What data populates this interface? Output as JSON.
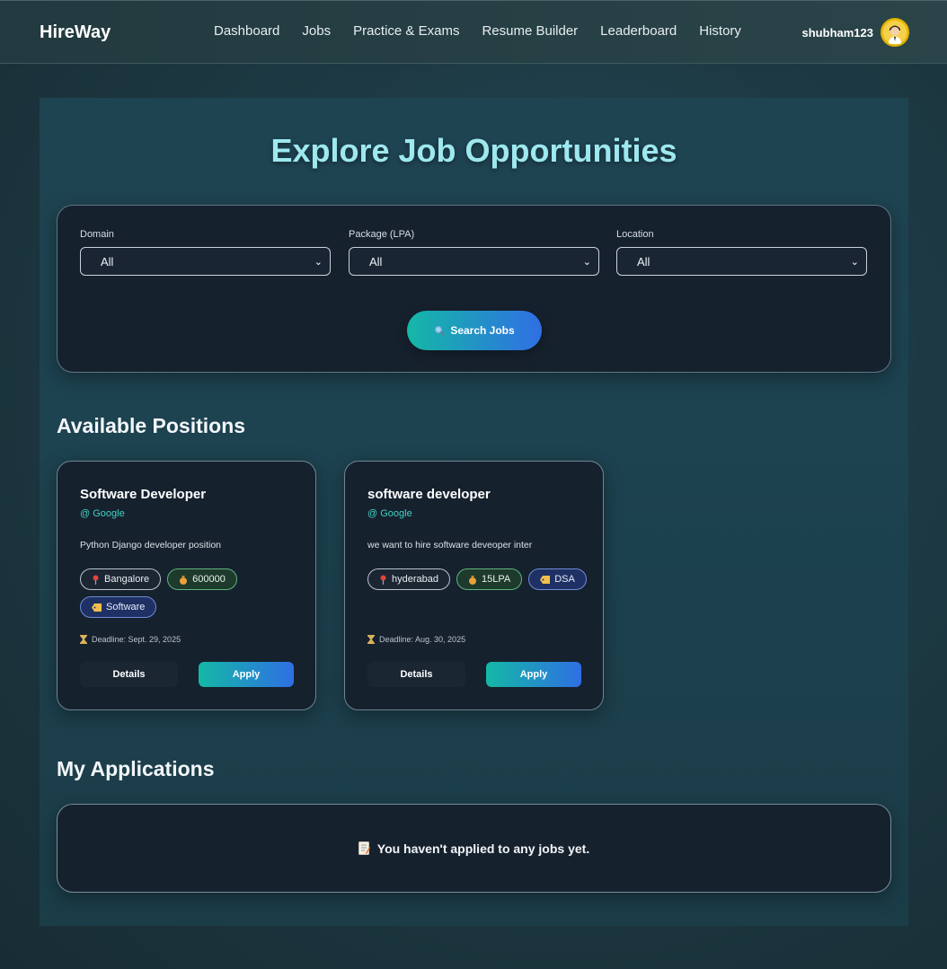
{
  "nav": {
    "brand": "HireWay",
    "links": [
      "Dashboard",
      "Jobs",
      "Practice & Exams",
      "Resume Builder",
      "Leaderboard",
      "History"
    ],
    "username": "shubham123",
    "avatar_icon": "user-avatar-icon"
  },
  "page": {
    "title": "Explore Job Opportunities"
  },
  "filters": {
    "domain": {
      "label": "Domain",
      "value": "All"
    },
    "package": {
      "label": "Package (LPA)",
      "value": "All"
    },
    "location": {
      "label": "Location",
      "value": "All"
    },
    "search_label": "Search Jobs",
    "search_icon": "magnifier-icon"
  },
  "positions": {
    "heading": "Available Positions",
    "jobs": [
      {
        "title": "Software Developer",
        "company": "@ Google",
        "description": "Python Django developer position",
        "location": "Bangalore",
        "package": "600000",
        "domain": "Software",
        "deadline": "Deadline: Sept. 29, 2025",
        "details_label": "Details",
        "apply_label": "Apply"
      },
      {
        "title": "software developer",
        "company": "@ Google",
        "description": "we want to hire software deveoper inter",
        "location": "hyderabad",
        "package": "15LPA",
        "domain": "DSA",
        "deadline": "Deadline: Aug. 30, 2025",
        "details_label": "Details",
        "apply_label": "Apply"
      }
    ]
  },
  "applications": {
    "heading": "My Applications",
    "empty_text": "You haven't applied to any jobs yet.",
    "empty_icon": "memo-icon"
  },
  "colors": {
    "accent_teal": "#14b8a6",
    "accent_blue": "#2f6fe4",
    "title_cyan": "#9ee8ef"
  }
}
